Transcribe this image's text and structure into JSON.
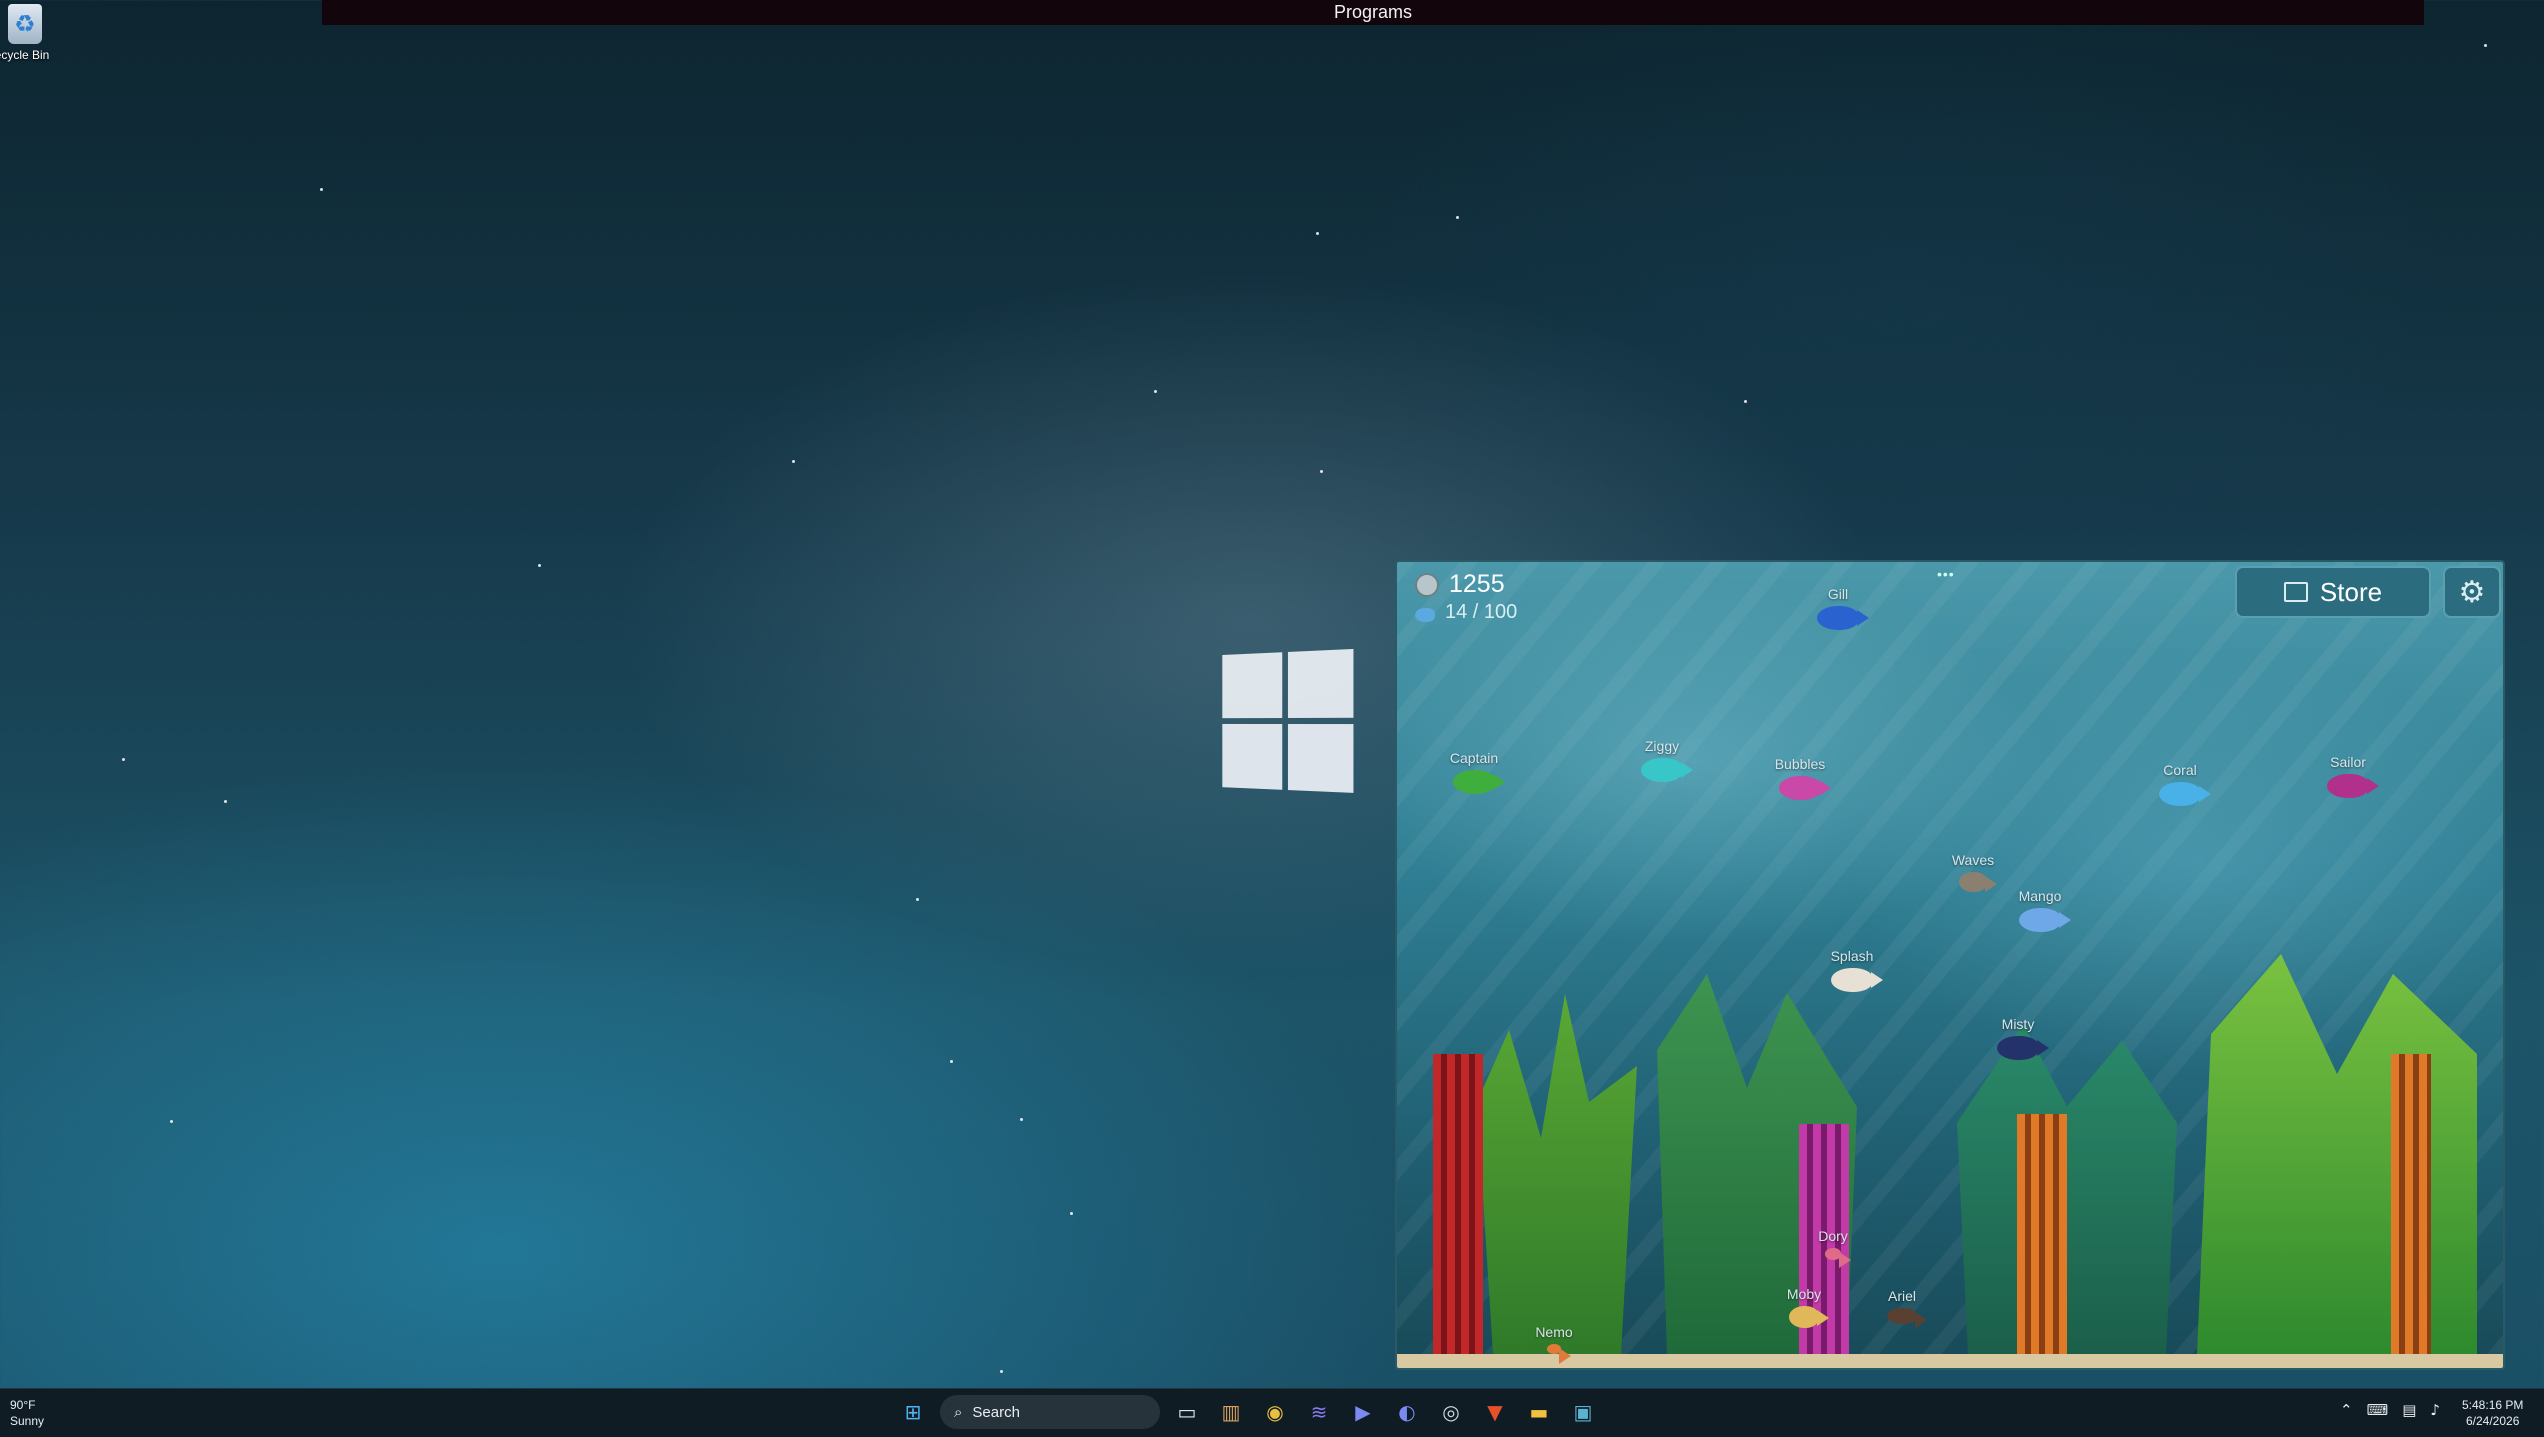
{
  "desktop": {
    "programs_bar_title": "Programs",
    "recycle_bin_label": "ecycle Bin"
  },
  "aquarium": {
    "coins": "1255",
    "fish_count": "14 / 100",
    "store_label": "Store",
    "fish": [
      {
        "name": "Gill",
        "color": "#2a62d0"
      },
      {
        "name": "Captain",
        "color": "#3fae3c"
      },
      {
        "name": "Ziggy",
        "color": "#39c6c8"
      },
      {
        "name": "Bubbles",
        "color": "#c948a8"
      },
      {
        "name": "Coral",
        "color": "#4ab0e8"
      },
      {
        "name": "Sailor",
        "color": "#b0308c"
      },
      {
        "name": "Waves",
        "color": "#8b8070"
      },
      {
        "name": "Mango",
        "color": "#6ea8e8"
      },
      {
        "name": "Splash",
        "color": "#e6e1d4"
      },
      {
        "name": "Misty",
        "color": "#23326a"
      },
      {
        "name": "Dory",
        "color": "#e06a8a"
      },
      {
        "name": "Moby",
        "color": "#e0b85a"
      },
      {
        "name": "Ariel",
        "color": "#5a4030"
      },
      {
        "name": "Nemo",
        "color": "#e07a3a"
      }
    ]
  },
  "taskbar": {
    "weather_temp": "90°F",
    "weather_desc": "Sunny",
    "search_label": "Search",
    "time": "5:48:16 PM",
    "date": "6/24/2026"
  }
}
